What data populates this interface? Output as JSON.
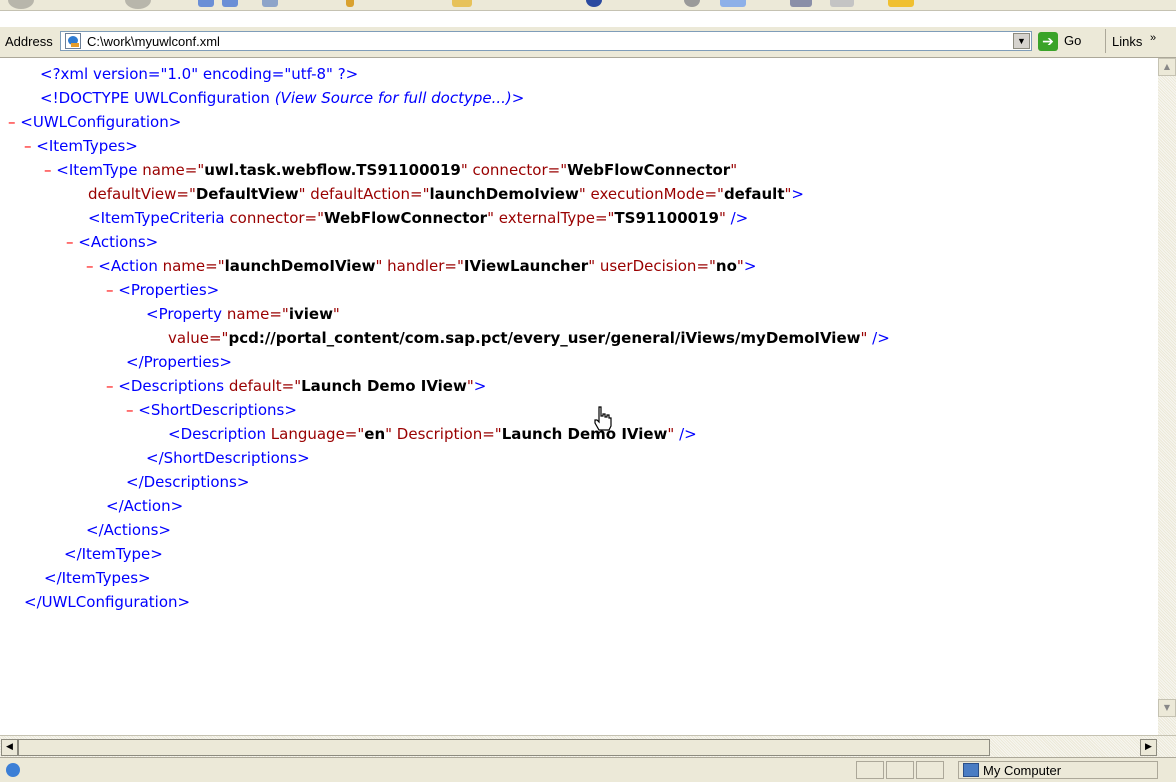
{
  "address_bar": {
    "label": "Address",
    "url": "C:\\work\\myuwlconf.xml",
    "go_label": "Go",
    "links_label": "Links",
    "chevron": "»",
    "dropdown_glyph": "▼",
    "go_arrow": "➔"
  },
  "xml": {
    "decl": {
      "text": "<?xml version=\"1.0\" encoding=\"utf-8\" ?>"
    },
    "doctype": {
      "prefix": "<!DOCTYPE UWLConfiguration ",
      "note": "(View Source for full doctype...)",
      "suffix": ">"
    },
    "uwl_open": {
      "tag": "<UWLConfiguration>"
    },
    "itemtypes_open": {
      "tag": "<ItemTypes>"
    },
    "itemtype_open": {
      "start": "<ItemType",
      "a1_name": " name=\"",
      "a1_val": "uwl.task.webflow.TS91100019",
      "a1_close": "\"",
      "a2_name": " connector=\"",
      "a2_val": "WebFlowConnector",
      "a2_close": "\""
    },
    "itemtype_cont": {
      "a3_name": "defaultView=\"",
      "a3_val": "DefaultView",
      "a3_close": "\"",
      "a4_name": " defaultAction=\"",
      "a4_val": "launchDemoIview",
      "a4_close": "\"",
      "a5_name": " executionMode=\"",
      "a5_val": "default",
      "a5_close": "\"",
      "end": ">"
    },
    "criteria": {
      "start": "<ItemTypeCriteria",
      "a1_name": " connector=\"",
      "a1_val": "WebFlowConnector",
      "a1_close": "\"",
      "a2_name": " externalType=\"",
      "a2_val": "TS91100019",
      "a2_close": "\"",
      "end": " />"
    },
    "actions_open": {
      "tag": "<Actions>"
    },
    "action_open": {
      "start": "<Action",
      "a1_name": " name=\"",
      "a1_val": "launchDemoIView",
      "a1_close": "\"",
      "a2_name": " handler=\"",
      "a2_val": "IViewLauncher",
      "a2_close": "\"",
      "a3_name": " userDecision=\"",
      "a3_val": "no",
      "a3_close": "\"",
      "end": ">"
    },
    "properties_open": {
      "tag": "<Properties>"
    },
    "property": {
      "start": "<Property",
      "a1_name": " name=\"",
      "a1_val": "iview",
      "a1_close": "\""
    },
    "property_cont": {
      "a2_name": "value=\"",
      "a2_val": "pcd://portal_content/com.sap.pct/every_user/general/iViews/myDemoIView",
      "a2_close": "\"",
      "end": " />"
    },
    "properties_close": {
      "tag": "</Properties>"
    },
    "descriptions_open": {
      "start": "<Descriptions",
      "a1_name": " default=\"",
      "a1_val": "Launch Demo IView",
      "a1_close": "\"",
      "end": ">"
    },
    "shortdesc_open": {
      "tag": "<ShortDescriptions>"
    },
    "description": {
      "start": "<Description",
      "a1_name": " Language=\"",
      "a1_val": "en",
      "a1_close": "\"",
      "a2_name": " Description=\"",
      "a2_val": "Launch Demo IView",
      "a2_close": "\"",
      "end": " />"
    },
    "shortdesc_close": {
      "tag": "</ShortDescriptions>"
    },
    "descriptions_close": {
      "tag": "</Descriptions>"
    },
    "action_close": {
      "tag": "</Action>"
    },
    "actions_close": {
      "tag": "</Actions>"
    },
    "itemtype_close": {
      "tag": "</ItemType>"
    },
    "itemtypes_close": {
      "tag": "</ItemTypes>"
    },
    "uwl_close": {
      "tag": "</UWLConfiguration>"
    },
    "collapse_marker": "–"
  },
  "scrollbar": {
    "left_arrow": "◀",
    "right_arrow": "▶",
    "up_arrow": "▲",
    "down_arrow": "▼"
  },
  "status_bar": {
    "zone": "My Computer"
  }
}
